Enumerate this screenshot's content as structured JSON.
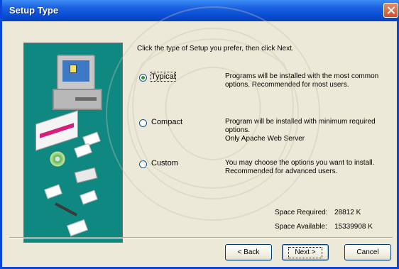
{
  "window": {
    "title": "Setup Type"
  },
  "prompt": "Click the type of Setup you prefer, then click Next.",
  "options": [
    {
      "label": "Typical",
      "selected": true,
      "description": [
        "Programs will be installed with the most common",
        "options. Recommended for most users."
      ]
    },
    {
      "label": "Compact",
      "selected": false,
      "description": [
        "Program will be installed with minimum required",
        "options.",
        "Only Apache Web Server"
      ]
    },
    {
      "label": "Custom",
      "selected": false,
      "description": [
        "You may choose the options you want to install.",
        "Recommended for advanced users."
      ]
    }
  ],
  "space": {
    "required_label": "Space Required:",
    "required_value": "28812 K",
    "available_label": "Space Available:",
    "available_value": "15339908 K"
  },
  "buttons": {
    "back": "< Back",
    "next": "Next >",
    "cancel": "Cancel"
  },
  "colors": {
    "title_bar": "#0a4fd6",
    "dialog_bg": "#ece9d8",
    "art_bg": "#0e8880",
    "close": "#d2502a"
  },
  "icons": [
    "close-icon",
    "computer-illustration-icon"
  ]
}
